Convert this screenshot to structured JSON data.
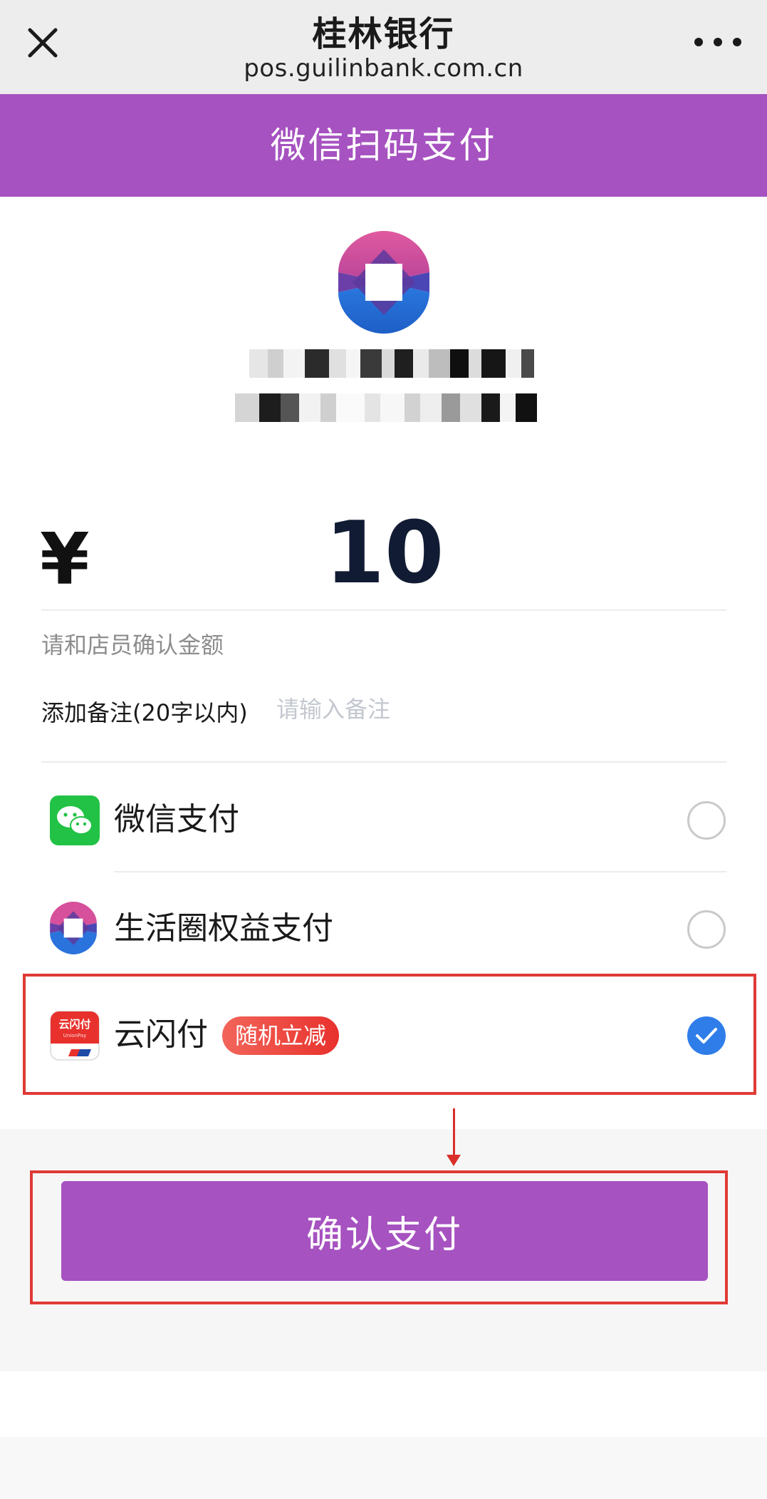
{
  "browser": {
    "title": "桂林银行",
    "url": "pos.guilinbank.com.cn"
  },
  "header": {
    "title": "微信扫码支付"
  },
  "payment": {
    "currency_symbol": "¥",
    "amount": "10",
    "confirm_hint": "请和店员确认金额",
    "remark_label": "添加备注(20字以内)",
    "remark_placeholder": "请输入备注"
  },
  "methods": [
    {
      "label": "微信支付",
      "icon": "wechat-pay-icon",
      "selected": false
    },
    {
      "label": "生活圈权益支付",
      "icon": "guilinbank-life-icon",
      "selected": false
    },
    {
      "label": "云闪付",
      "icon": "unionpay-quickpass-icon",
      "selected": true,
      "badge": "随机立减",
      "icon_text": "云闪付",
      "icon_subtext": "UnionPay"
    }
  ],
  "confirm_button": "确认支付",
  "colors": {
    "brand_purple": "#a652c0",
    "radio_checked": "#2f7de9",
    "highlight_red": "#e03a35",
    "promo_red": "#e8312d",
    "wechat_green": "#21c245"
  }
}
